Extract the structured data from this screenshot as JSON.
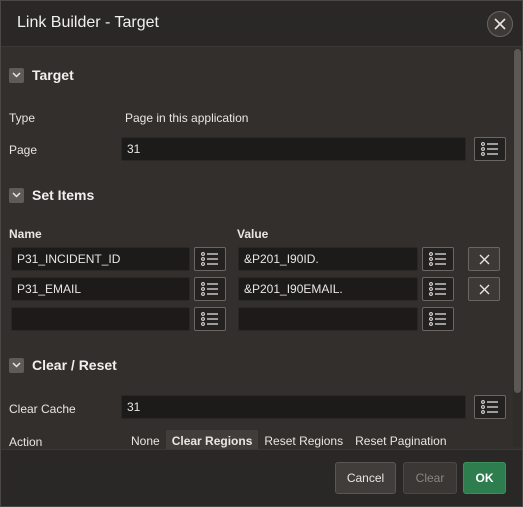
{
  "dialog": {
    "title": "Link Builder - Target"
  },
  "target": {
    "heading": "Target",
    "type_label": "Type",
    "type_value": "Page in this application",
    "page_label": "Page",
    "page_value": "31"
  },
  "set_items": {
    "heading": "Set Items",
    "name_header": "Name",
    "value_header": "Value",
    "rows": [
      {
        "name": "P31_INCIDENT_ID",
        "value": "&P201_I90ID."
      },
      {
        "name": "P31_EMAIL",
        "value": "&P201_I90EMAIL."
      },
      {
        "name": "",
        "value": ""
      }
    ]
  },
  "clear_reset": {
    "heading": "Clear / Reset",
    "clear_cache_label": "Clear Cache",
    "clear_cache_value": "31",
    "action_label": "Action",
    "action_options": [
      "None",
      "Clear Regions",
      "Reset Regions",
      "Reset Pagination"
    ],
    "action_selected": "Clear Regions"
  },
  "footer": {
    "cancel_label": "Cancel",
    "clear_label": "Clear",
    "ok_label": "OK"
  },
  "colors": {
    "ok_button": "#2e7d4f",
    "background": "#322f2c"
  }
}
